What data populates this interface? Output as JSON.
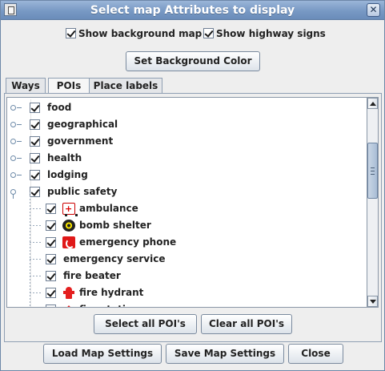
{
  "window": {
    "title": "Select map Attributes to display",
    "close_label": "✕"
  },
  "options": {
    "show_background_map": {
      "label": "Show background map",
      "checked": true
    },
    "show_highway_signs": {
      "label": "Show highway signs",
      "checked": true
    }
  },
  "set_background_color_label": "Set Background Color",
  "tabs": [
    {
      "label": "Ways",
      "active": false
    },
    {
      "label": "POIs",
      "active": true
    },
    {
      "label": "Place labels",
      "active": false
    }
  ],
  "poi_tree": {
    "categories": [
      {
        "label": "food",
        "checked": true,
        "expanded": false
      },
      {
        "label": "geographical",
        "checked": true,
        "expanded": false
      },
      {
        "label": "government",
        "checked": true,
        "expanded": false
      },
      {
        "label": "health",
        "checked": true,
        "expanded": false
      },
      {
        "label": "lodging",
        "checked": true,
        "expanded": false
      },
      {
        "label": "public safety",
        "checked": true,
        "expanded": true
      }
    ],
    "public_safety_items": [
      {
        "label": "ambulance",
        "icon": "ambulance-icon",
        "checked": true
      },
      {
        "label": "bomb shelter",
        "icon": "radiation-icon",
        "checked": true
      },
      {
        "label": "emergency phone",
        "icon": "phone-icon",
        "checked": true
      },
      {
        "label": "emergency service",
        "icon": "",
        "checked": true
      },
      {
        "label": "fire beater",
        "icon": "",
        "checked": true
      },
      {
        "label": "fire hydrant",
        "icon": "hydrant-icon",
        "checked": true
      },
      {
        "label": "fire station",
        "icon": "fire-station-icon",
        "checked": true
      }
    ]
  },
  "poi_buttons": {
    "select_all": "Select all POI's",
    "clear_all": "Clear all POI's"
  },
  "footer_buttons": {
    "load": "Load Map Settings",
    "save": "Save Map Settings",
    "close": "Close"
  }
}
